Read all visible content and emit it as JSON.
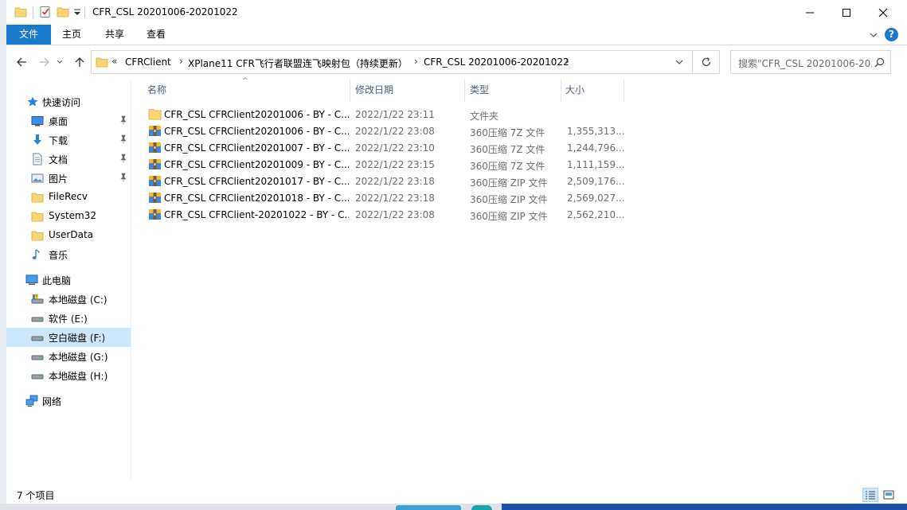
{
  "window": {
    "title": "CFR_CSL 20201006-20201022",
    "controls": {
      "minimize": "─",
      "maximize": "☐",
      "close": "✕"
    }
  },
  "ribbon": {
    "tabs": [
      "文件",
      "主页",
      "共享",
      "查看"
    ],
    "help_icon": "?"
  },
  "address": {
    "overflow": "«",
    "crumbs": [
      "CFRClient",
      "XPlane11 CFR飞行者联盟连飞映射包（持续更新）",
      "CFR_CSL 20201006-20201022"
    ],
    "separator": "›"
  },
  "search": {
    "placeholder": "搜索\"CFR_CSL 20201006-20..."
  },
  "nav_pane": {
    "quick_access": "快速访问",
    "quick_items": [
      {
        "label": "桌面",
        "icon": "desktop-icon",
        "pinned": true
      },
      {
        "label": "下载",
        "icon": "download-icon",
        "pinned": true
      },
      {
        "label": "文档",
        "icon": "documents-icon",
        "pinned": true
      },
      {
        "label": "图片",
        "icon": "pictures-icon",
        "pinned": true
      },
      {
        "label": "FileRecv",
        "icon": "folder-icon",
        "pinned": false
      },
      {
        "label": "System32",
        "icon": "folder-icon",
        "pinned": false
      },
      {
        "label": "UserData",
        "icon": "folder-icon",
        "pinned": false
      },
      {
        "label": "音乐",
        "icon": "music-icon",
        "pinned": false
      }
    ],
    "this_pc": "此电脑",
    "drives": [
      {
        "label": "本地磁盘 (C:)",
        "selected": false
      },
      {
        "label": "软件 (E:)",
        "selected": false
      },
      {
        "label": "空白磁盘 (F:)",
        "selected": true
      },
      {
        "label": "本地磁盘 (G:)",
        "selected": false
      },
      {
        "label": "本地磁盘 (H:)",
        "selected": false
      }
    ],
    "network": "网络"
  },
  "columns": {
    "name": "名称",
    "date": "修改日期",
    "type": "类型",
    "size": "大小"
  },
  "files": [
    {
      "name": "CFR_CSL CFRClient20201006 - BY - C...",
      "date": "2022/1/22 23:11",
      "type": "文件夹",
      "size": "",
      "kind": "folder"
    },
    {
      "name": "CFR_CSL CFRClient20201006 - BY - C...",
      "date": "2022/1/22 23:08",
      "type": "360压缩 7Z 文件",
      "size": "1,355,313...",
      "kind": "archive"
    },
    {
      "name": "CFR_CSL CFRClient20201007 - BY - C...",
      "date": "2022/1/22 23:10",
      "type": "360压缩 7Z 文件",
      "size": "1,244,796...",
      "kind": "archive"
    },
    {
      "name": "CFR_CSL CFRClient20201009 - BY - C...",
      "date": "2022/1/22 23:15",
      "type": "360压缩 7Z 文件",
      "size": "1,111,159...",
      "kind": "archive"
    },
    {
      "name": "CFR_CSL CFRClient20201017 - BY - C...",
      "date": "2022/1/22 23:18",
      "type": "360压缩 ZIP 文件",
      "size": "2,509,176...",
      "kind": "archive"
    },
    {
      "name": "CFR_CSL CFRClient20201018 - BY - C...",
      "date": "2022/1/22 23:18",
      "type": "360压缩 ZIP 文件",
      "size": "2,569,027...",
      "kind": "archive"
    },
    {
      "name": "CFR_CSL CFRClient-20201022 - BY - C...",
      "date": "2022/1/22 23:08",
      "type": "360压缩 ZIP 文件",
      "size": "2,562,210...",
      "kind": "archive"
    }
  ],
  "status": {
    "count": "7 个项目"
  },
  "colors": {
    "accent": "#1979ca",
    "selected_bg": "#cce8ff",
    "folder_yellow": "#f8d775",
    "header_text": "#4c607a"
  }
}
